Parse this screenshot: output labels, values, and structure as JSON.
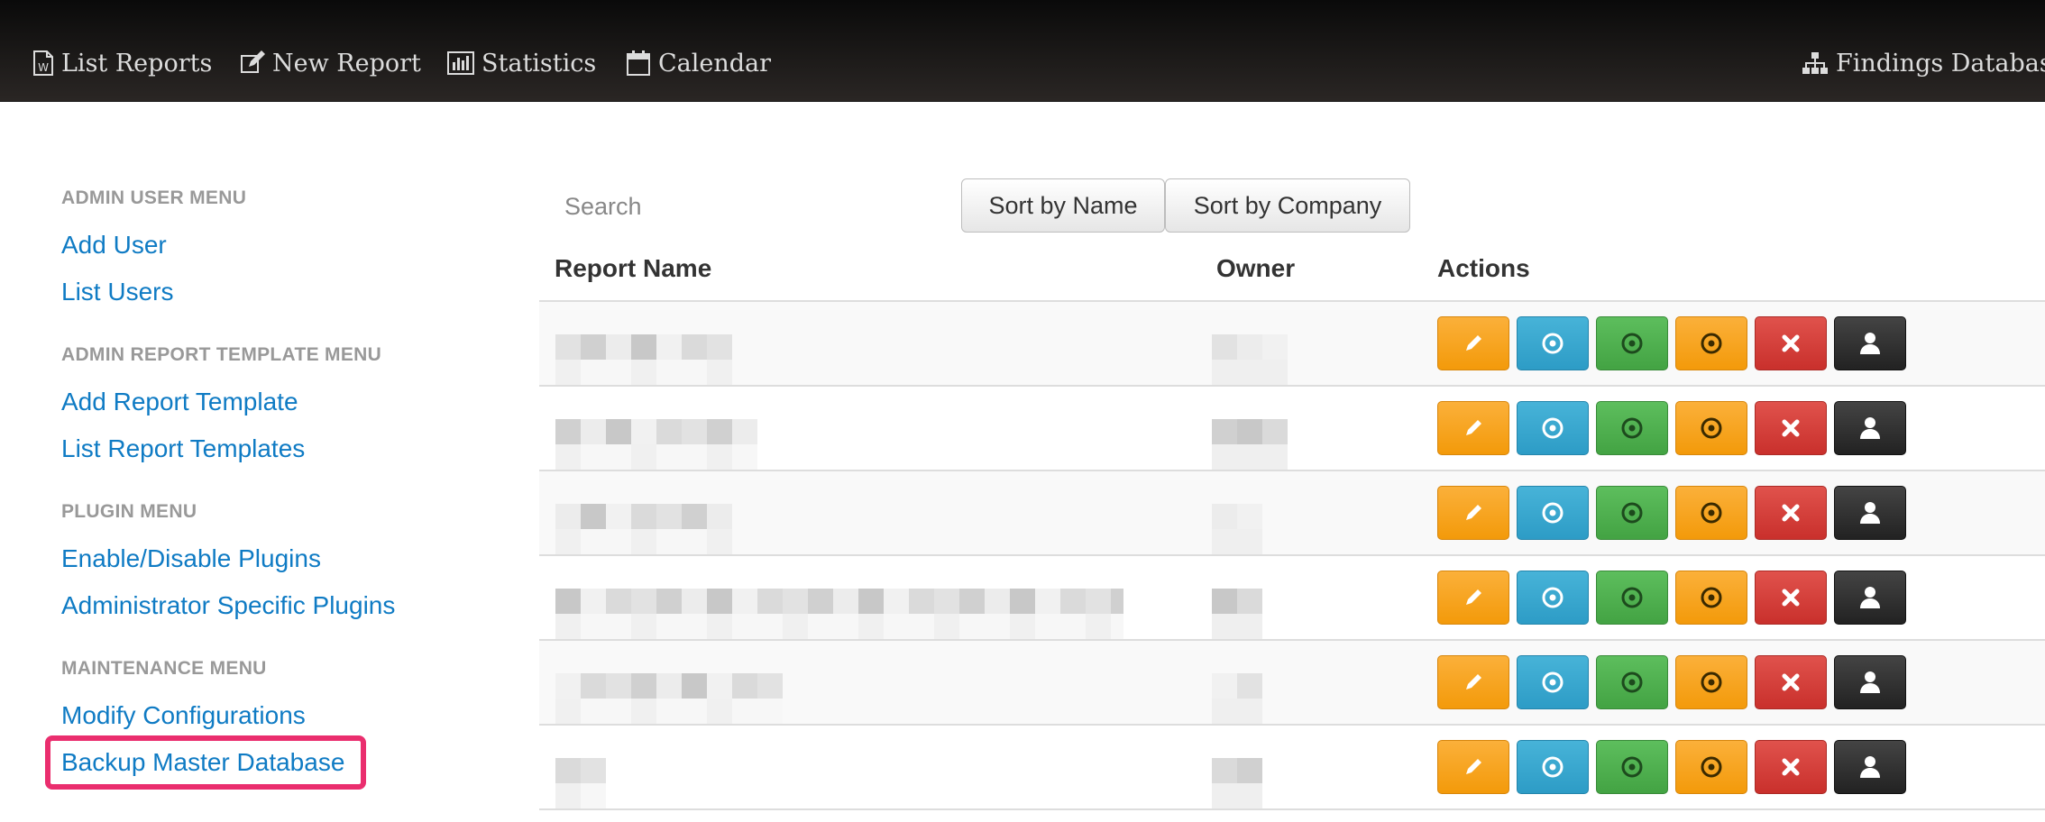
{
  "navbar": {
    "list_reports": "List Reports",
    "new_report": "New Report",
    "statistics": "Statistics",
    "calendar": "Calendar",
    "findings_database": "Findings Database"
  },
  "sidebar": {
    "admin_user_heading": "ADMIN USER MENU",
    "add_user": "Add User",
    "list_users": "List Users",
    "admin_template_heading": "ADMIN REPORT TEMPLATE MENU",
    "add_report_template": "Add Report Template",
    "list_report_templates": "List Report Templates",
    "plugin_heading": "PLUGIN MENU",
    "enable_disable_plugins": "Enable/Disable Plugins",
    "admin_specific_plugins": "Administrator Specific Plugins",
    "maintenance_heading": "MAINTENANCE MENU",
    "modify_configurations": "Modify Configurations",
    "backup_master_database": "Backup Master Database"
  },
  "main": {
    "search_placeholder": "Search",
    "sort_by_name": "Sort by Name",
    "sort_by_company": "Sort by Company",
    "columns": {
      "report_name": "Report Name",
      "owner": "Owner",
      "actions": "Actions"
    },
    "row_count": 6,
    "action_buttons": [
      "edit",
      "preview",
      "generate",
      "generate-alt",
      "delete",
      "owner"
    ]
  },
  "colors": {
    "navbar": "#1a1716",
    "link": "#0f7bc4",
    "highlight": "#ea2e6e",
    "btn_orange": "#f7a21a",
    "btn_blue": "#35a6ce",
    "btn_green": "#4cae4c",
    "btn_red": "#d9443e",
    "btn_dark": "#2e2e2e"
  }
}
